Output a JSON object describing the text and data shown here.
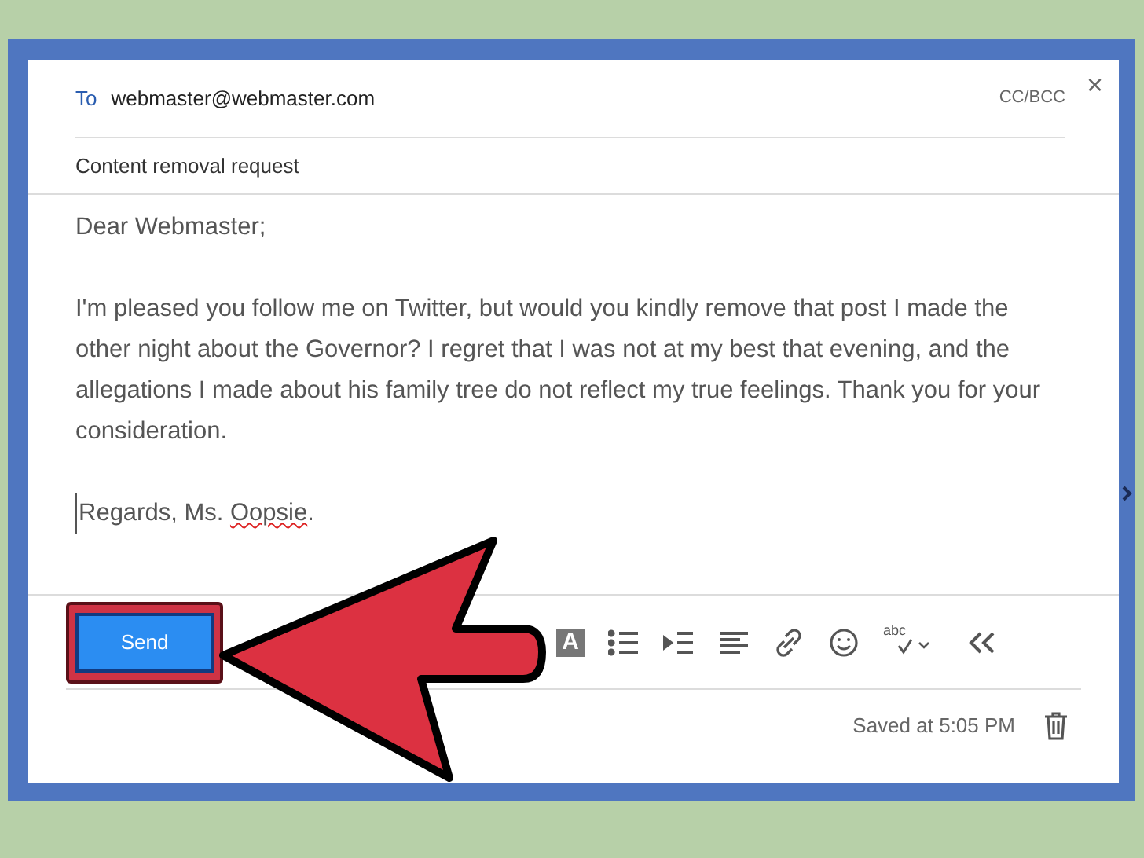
{
  "compose": {
    "close": "×",
    "to": {
      "label": "To",
      "value": "webmaster@webmaster.com",
      "cc_bcc": "CC/BCC"
    },
    "subject": "Content removal request",
    "body": [
      "Dear Webmaster;",
      "I'm pleased you follow me on Twitter, but would you kindly remove that post I made the other night about the Governor? I regret that I was not at my best that evening, and the allegations I made about his family tree do not reflect my true feelings. Thank you for your consideration."
    ],
    "signature": [
      {
        "text": "Regards, Ms. ",
        "misspelled": false
      },
      {
        "text": "Oopsie",
        "misspelled": true
      },
      {
        "text": ".",
        "misspelled": false
      }
    ],
    "send": "Send",
    "toolbar": [
      {
        "kind": "font-color",
        "glyph": "A"
      },
      {
        "kind": "bullets"
      },
      {
        "kind": "indent"
      },
      {
        "kind": "align"
      },
      {
        "kind": "link"
      },
      {
        "kind": "emoji"
      },
      {
        "kind": "spellcheck",
        "glyph": "abc"
      },
      {
        "kind": "collapse"
      }
    ],
    "saved": "Saved at 5:05 PM"
  }
}
